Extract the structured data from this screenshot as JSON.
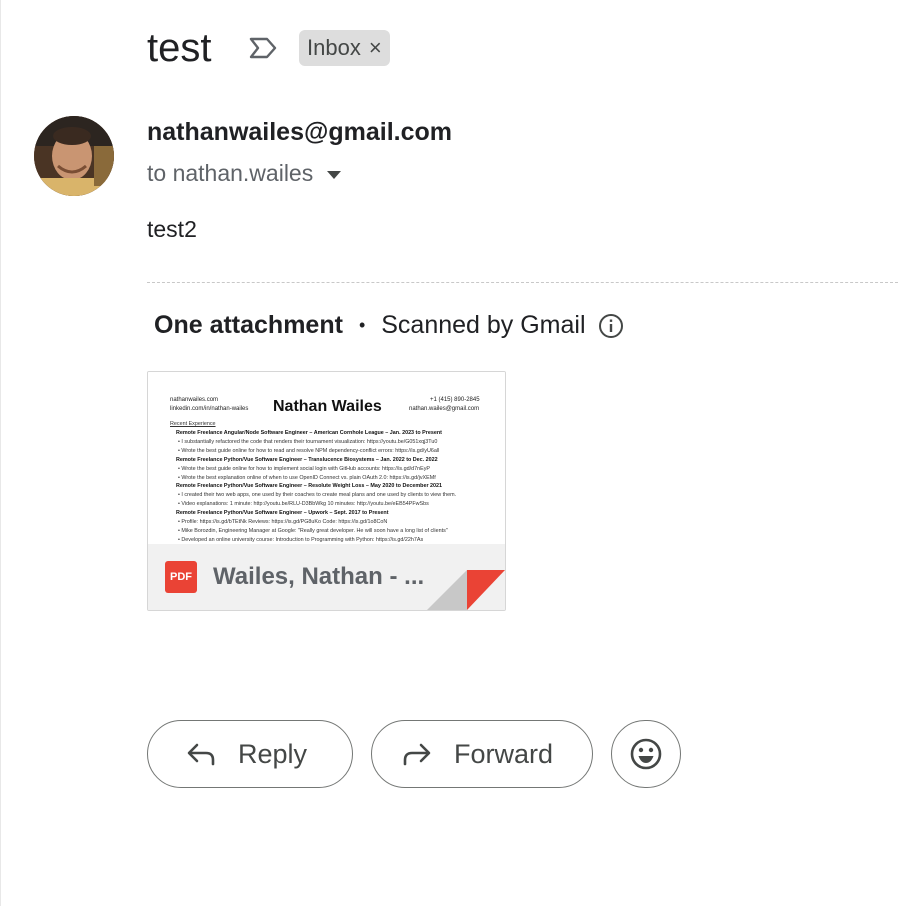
{
  "subject": "test",
  "label": {
    "name": "Inbox",
    "remove_glyph": "×"
  },
  "sender": {
    "email": "nathanwailes@gmail.com",
    "recipient": "to nathan.wailes"
  },
  "body": "test2",
  "attachments": {
    "count_label": "One attachment",
    "separator": "•",
    "scan_label": "Scanned by Gmail",
    "file_name": "Wailes, Nathan - ...",
    "file_type": "PDF",
    "preview": {
      "site": "nathanwailes.com",
      "linkedin": "linkedin.com/in/nathan-wailes",
      "name": "Nathan Wailes",
      "phone": "+1 (415) 890-2845",
      "email": "nathan.wailes@gmail.com",
      "section": "Recent Experience",
      "lines": [
        "Remote Freelance Angular/Node Software Engineer – American Cornhole League – Jan. 2023 to Present",
        "• I substantially refactored the code that renders their tournament visualization: https://youtu.be/G051xqj3Tu0",
        "• Wrote the best guide online for how to read and resolve NPM dependency-conflict errors: https://is.gd/yU6all",
        "Remote Freelance Python/Vue Software Engineer – Translucence Biosystems – Jan. 2022 to Dec. 2022",
        "• Wrote the best guide online for how to implement social login with GitHub accounts: https://is.gd/d7nEyP",
        "• Wrote the best explanation online of when to use OpenID Connect vs. plain OAuth 2.0: https://is.gd/jvXEMf",
        "Remote Freelance Python/Vue Software Engineer – Resolute Weight Loss – May 2020 to December 2021",
        "• I created their two web apps, one used by their coaches to create meal plans and one used by clients to view them.",
        "• Video explanations: 1 minute: http://youtu.be/RLU-D3BbWkg 10 minutes: http://youtu.be/eEB54PFwSbs",
        "Remote Freelance Python/Vue Software Engineer – Upwork – Sept. 2017 to Present",
        "• Profile: https://is.gd/bTEtNk          Reviews: https://is.gd/PG8uKo          Code: https://is.gd/1o8CoN",
        "• Mike Borozdin, Engineering Manager at Google: \"Really great developer. He will soon have a long list of clients\"",
        "• Developed an online university course: Introduction to Programming with Python: https://is.gd/22h7As"
      ]
    }
  },
  "actions": {
    "reply": "Reply",
    "forward": "Forward"
  },
  "colors": {
    "accent_red": "#ea4335",
    "chip_bg": "#dddddd",
    "text": "#202124",
    "muted": "#5f6368"
  }
}
